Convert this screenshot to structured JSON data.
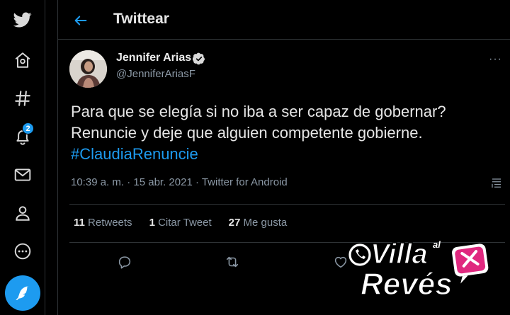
{
  "nav": {
    "items": [
      {
        "name": "home",
        "icon": "home-icon"
      },
      {
        "name": "explore",
        "icon": "hashtag-icon"
      },
      {
        "name": "notifications",
        "icon": "bell-icon",
        "badge": "2"
      },
      {
        "name": "messages",
        "icon": "mail-icon"
      },
      {
        "name": "profile",
        "icon": "user-icon"
      },
      {
        "name": "more",
        "icon": "more-circle-icon"
      }
    ],
    "compose_icon": "feather-icon",
    "logo_icon": "twitter-bird-icon"
  },
  "header": {
    "title": "Twittear"
  },
  "tweet": {
    "author_name": "Jennifer Arias",
    "handle": "@JenniferAriasF",
    "verified": true,
    "text_line1": "Para que se elegía si no iba a ser capaz de gobernar?",
    "text_line2": "Renuncie y deje que alguien competente gobierne.",
    "hashtag": "#ClaudiaRenuncie",
    "meta": "10:39 a. m. · 15 abr. 2021 · Twitter for Android",
    "retweets_count": "11",
    "retweets_label": "Retweets",
    "quotes_count": "1",
    "quotes_label": "Citar Tweet",
    "likes_count": "27",
    "likes_label": "Me gusta"
  },
  "watermark": {
    "text": "Villa al Revés"
  },
  "colors": {
    "accent": "#1d9bf0",
    "background": "#000000",
    "muted": "#8b98a5",
    "border": "#2f3336"
  }
}
